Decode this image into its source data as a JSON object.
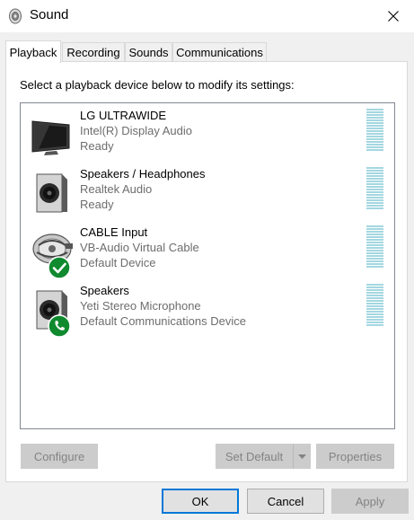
{
  "window": {
    "title": "Sound",
    "icon": "speaker-icon",
    "close_icon": "close-icon"
  },
  "tabs": [
    {
      "label": "Playback",
      "active": true
    },
    {
      "label": "Recording",
      "active": false
    },
    {
      "label": "Sounds",
      "active": false
    },
    {
      "label": "Communications",
      "active": false
    }
  ],
  "panel": {
    "instruction": "Select a playback device below to modify its settings:",
    "devices": [
      {
        "name": "LG ULTRAWIDE",
        "description": "Intel(R) Display Audio",
        "status": "Ready",
        "icon": "monitor-icon",
        "badge": "none"
      },
      {
        "name": "Speakers / Headphones",
        "description": "Realtek Audio",
        "status": "Ready",
        "icon": "speaker-box-icon",
        "badge": "none"
      },
      {
        "name": "CABLE Input",
        "description": "VB-Audio Virtual Cable",
        "status": "Default Device",
        "icon": "cable-icon",
        "badge": "default-check-icon"
      },
      {
        "name": "Speakers",
        "description": "Yeti Stereo Microphone",
        "status": "Default Communications Device",
        "icon": "speaker-box-icon",
        "badge": "phone-icon"
      }
    ],
    "buttons": {
      "configure": "Configure",
      "set_default": "Set Default",
      "properties": "Properties"
    }
  },
  "footer": {
    "ok": "OK",
    "cancel": "Cancel",
    "apply": "Apply"
  },
  "colors": {
    "accent": "#0078d7",
    "meter": "#a4d7e1",
    "badge_green": "#0f8a2f",
    "disabled_text": "#838383",
    "secondary_text": "#6d6d6d"
  }
}
